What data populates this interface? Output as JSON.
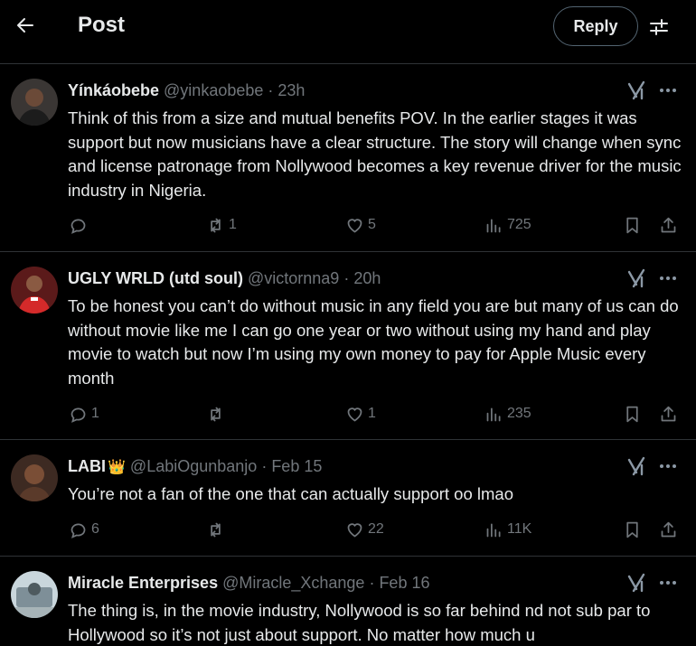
{
  "header": {
    "title": "Post",
    "reply_label": "Reply"
  },
  "icons": {
    "back": "arrow-left-icon",
    "settings": "sliders-icon",
    "grok": "grok-icon",
    "more": "more-icon",
    "reply": "reply-icon",
    "repost": "repost-icon",
    "like": "heart-icon",
    "views": "views-icon",
    "bookmark": "bookmark-icon",
    "share": "share-icon"
  },
  "colors": {
    "background": "#000000",
    "text": "#e7e9ea",
    "muted": "#71767b",
    "divider": "#2f3336"
  },
  "tweets": [
    {
      "name": "Yínkáobebe",
      "handle": "@yinkaobebe",
      "time": "23h",
      "text": "Think of this from a size and mutual benefits POV. In the earlier stages it was support but now musicians have a clear structure. The story will change when sync and license patronage from Nollywood becomes a key revenue driver for the music industry in Nigeria.",
      "replies": "",
      "reposts": "1",
      "likes": "5",
      "views": "725"
    },
    {
      "name": "UGLY WRLD (utd soul)",
      "handle": "@victornna9",
      "time": "20h",
      "text": "To be honest  you can’t do without music in any field you are but many of us can do without movie like me I can go one year or two without using my hand and play movie to watch but now I’m using my own money to pay for Apple Music every month",
      "replies": "1",
      "reposts": "",
      "likes": "1",
      "views": "235"
    },
    {
      "name": "LABI",
      "badge": "👑",
      "handle": "@LabiOgunbanjo",
      "time": "Feb 15",
      "text": "You’re not a fan of the one that can actually support oo lmao",
      "replies": "6",
      "reposts": "",
      "likes": "22",
      "views": "11K"
    },
    {
      "name": "Miracle Enterprises",
      "handle": "@Miracle_Xchange",
      "time": "Feb 16",
      "text": "The thing is, in the movie industry, Nollywood is so far behind nd not sub par to Hollywood so it’s not just about support. No matter how much u"
    }
  ]
}
